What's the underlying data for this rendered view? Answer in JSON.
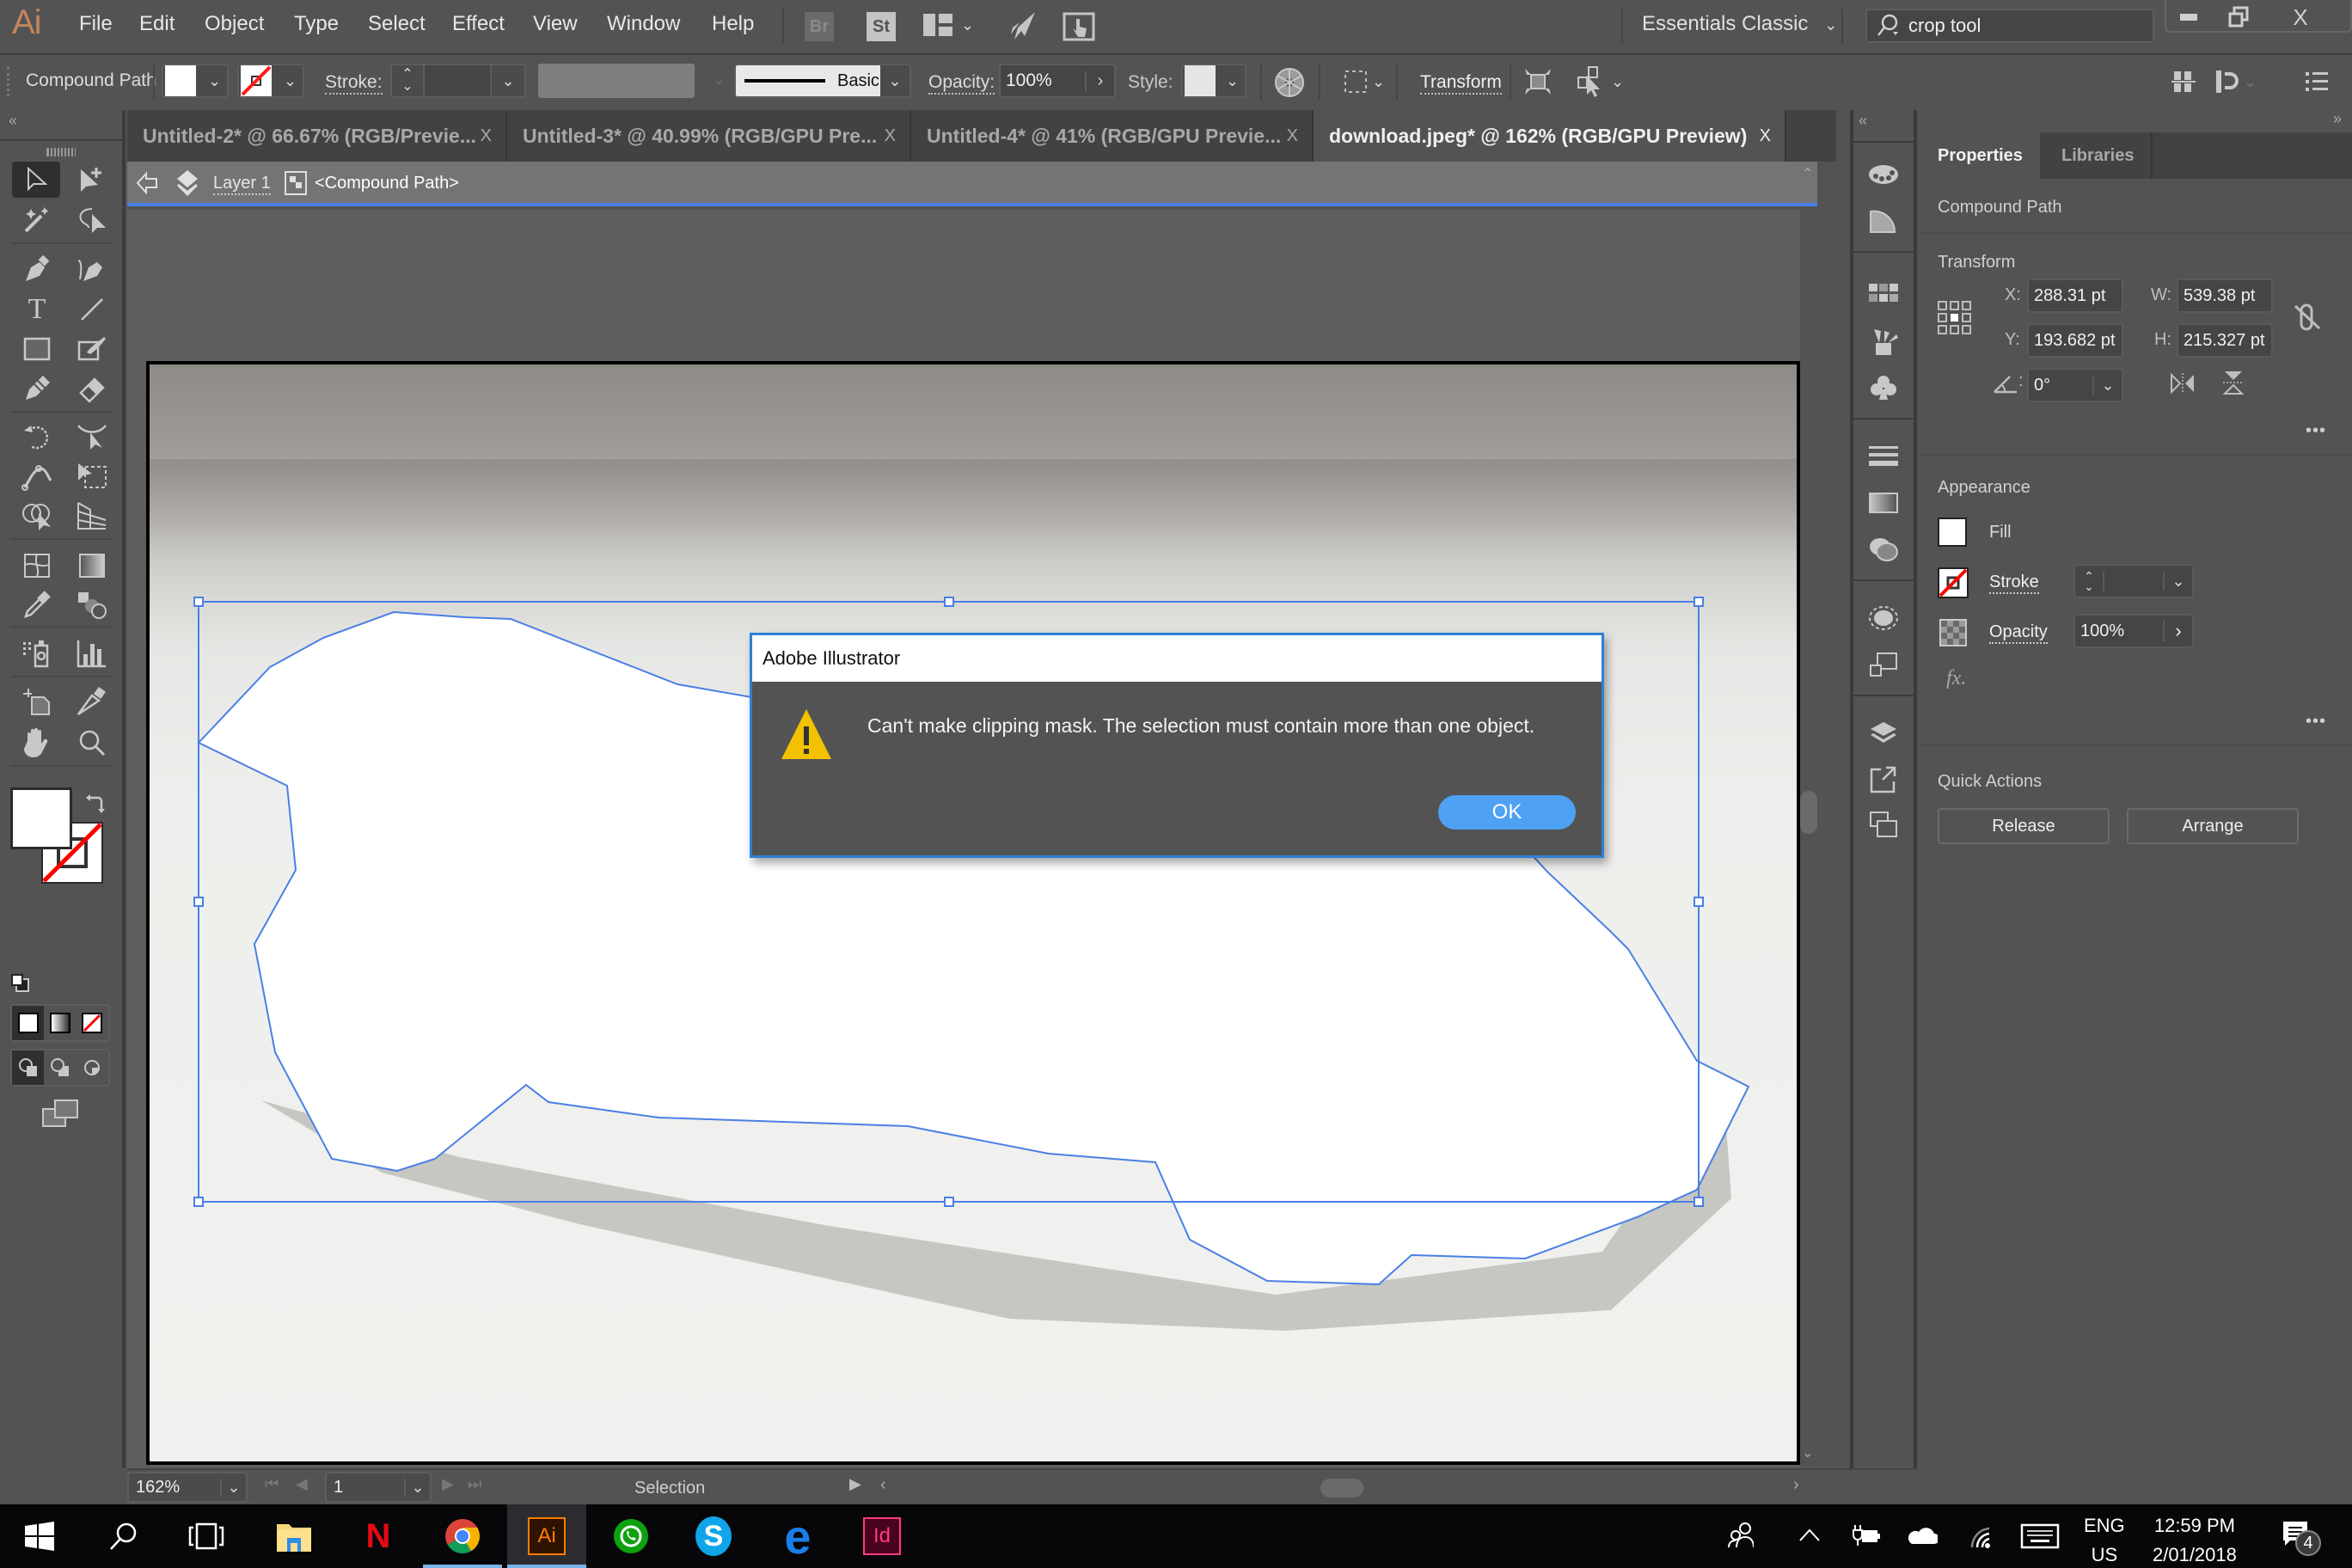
{
  "app": {
    "logo": "Ai",
    "menu": [
      "File",
      "Edit",
      "Object",
      "Type",
      "Select",
      "Effect",
      "View",
      "Window",
      "Help"
    ],
    "bridge_labels": {
      "br": "Br",
      "st": "St"
    },
    "workspace": "Essentials Classic",
    "search_value": "crop tool",
    "window_controls": {
      "minimize": "–",
      "restore": "❐",
      "close": "X"
    }
  },
  "controlbar": {
    "selection_type": "Compound Path",
    "stroke_label": "Stroke:",
    "brush_label": "Basic",
    "opacity_label": "Opacity:",
    "opacity_value": "100%",
    "style_label": "Style:",
    "transform_label": "Transform",
    "colors": {
      "fill": "#ffffff",
      "stroke_none_slash": "#ff0000"
    }
  },
  "tabs": [
    {
      "label": "Untitled-2* @ 66.67% (RGB/Previe...",
      "close": "X",
      "active": false
    },
    {
      "label": "Untitled-3* @ 40.99% (RGB/GPU Pre...",
      "close": "X",
      "active": false
    },
    {
      "label": "Untitled-4* @ 41% (RGB/GPU Previe...",
      "close": "X",
      "active": false
    },
    {
      "label": "download.jpeg* @ 162% (RGB/GPU Preview)",
      "close": "X",
      "active": true
    }
  ],
  "breadcrumb": {
    "layer": "Layer 1",
    "object": "<Compound Path>"
  },
  "dialog": {
    "title": "Adobe Illustrator",
    "message": "Can't make clipping mask. The selection must contain more than one object.",
    "ok_label": "OK",
    "accent": "#4ea1f3",
    "warning_color": "#f2c200"
  },
  "properties": {
    "tabs": [
      "Properties",
      "Libraries"
    ],
    "object_type": "Compound Path",
    "transform": {
      "title": "Transform",
      "x_label": "X:",
      "x": "288.31 pt",
      "y_label": "Y:",
      "y": "193.682 pt",
      "w_label": "W:",
      "w": "539.38 pt",
      "h_label": "H:",
      "h": "215.327 pt",
      "angle_label": ":",
      "angle": "0°"
    },
    "appearance": {
      "title": "Appearance",
      "fill_label": "Fill",
      "stroke_label": "Stroke",
      "opacity_label": "Opacity",
      "opacity_value": "100%",
      "fx_label": "fx."
    },
    "quick_actions": {
      "title": "Quick Actions",
      "release": "Release",
      "arrange": "Arrange"
    },
    "more": "•••"
  },
  "statusbar": {
    "zoom": "162%",
    "artboard": "1",
    "tool": "Selection"
  },
  "taskbar": {
    "apps": [
      "file-explorer",
      "netflix",
      "chrome",
      "illustrator",
      "whatsapp",
      "skype",
      "edge",
      "indesign"
    ],
    "ai_label": "Ai",
    "id_label": "Id",
    "netflix_label": "N",
    "skype_label": "S",
    "edge_label": "e",
    "lang_top": "ENG",
    "lang_bottom": "US",
    "time": "12:59 PM",
    "date": "2/01/2018",
    "notifications": "4"
  }
}
